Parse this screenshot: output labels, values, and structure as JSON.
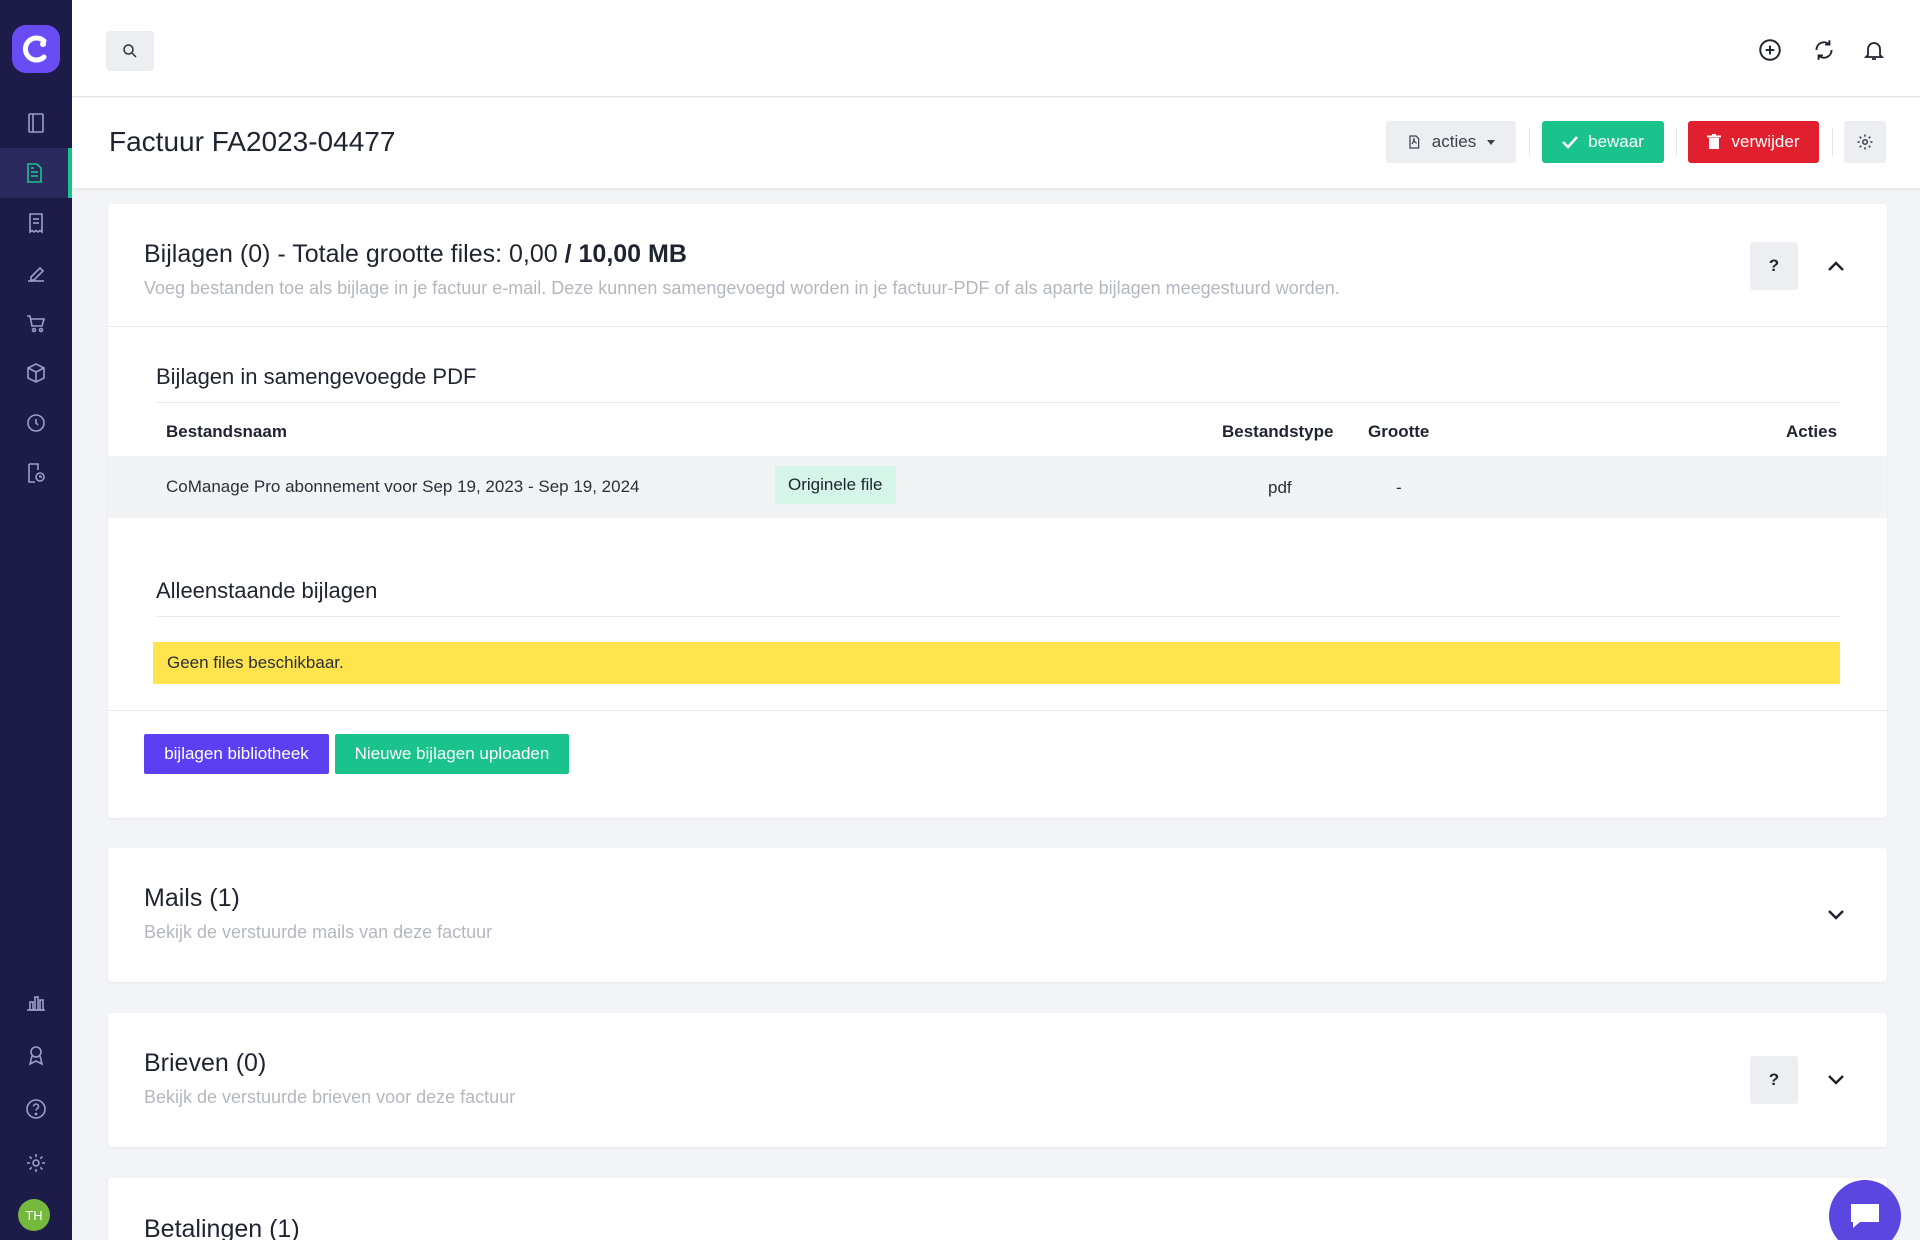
{
  "app": {
    "logo_letter": "C",
    "user_initials": "TH"
  },
  "header": {
    "page_title": "Factuur  FA2023-04477"
  },
  "toolbar": {
    "acties_label": "acties",
    "bewaar_label": "bewaar",
    "verwijder_label": "verwijder"
  },
  "bijlagen": {
    "title_prefix": "Bijlagen  (0) - Totale grootte files: 0,00",
    "title_bold": "/ 10,00 MB",
    "subtitle": "Voeg bestanden toe als bijlage in je factuur e-mail. Deze kunnen samengevoegd worden in je factuur-PDF of als aparte bijlagen meegestuurd worden.",
    "help_label": "?",
    "merged_title": "Bijlagen in samengevoegde PDF",
    "columns": {
      "name": "Bestandsnaam",
      "type": "Bestandstype",
      "size": "Grootte",
      "actions": "Acties"
    },
    "rows": [
      {
        "name": "CoManage Pro abonnement voor Sep 19, 2023 - Sep 19, 2024",
        "badge": "Originele file",
        "type": "pdf",
        "size": "-"
      }
    ],
    "standalone_title": "Alleenstaande bijlagen",
    "empty_message": "Geen files beschikbaar.",
    "library_button": "bijlagen bibliotheek",
    "upload_button": "Nieuwe bijlagen uploaden"
  },
  "mails": {
    "title": "Mails  (1)",
    "subtitle": "Bekijk de verstuurde mails van deze factuur"
  },
  "brieven": {
    "title": "Brieven  (0)",
    "subtitle": "Bekijk de verstuurde brieven voor deze factuur",
    "help_label": "?"
  },
  "betalingen": {
    "title": "Betalingen  (1)"
  },
  "colors": {
    "sidebar": "#1d1c49",
    "accent_green": "#1bc38c",
    "danger_red": "#e0202e",
    "primary_purple": "#5b47e0",
    "warning_yellow": "#ffe44d"
  }
}
